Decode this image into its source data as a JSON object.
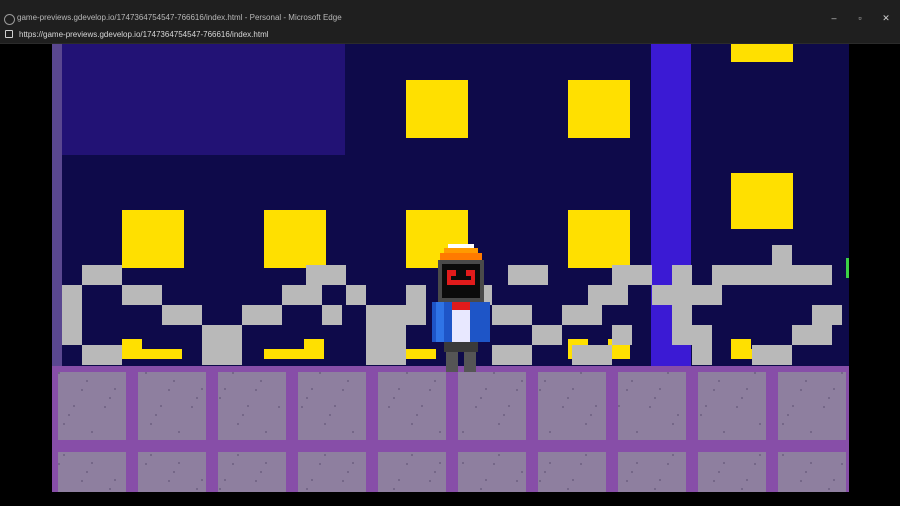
{
  "browser": {
    "window_title": "game-previews.gdevelop.io/1747364754547-766616/index.html - Personal - Microsoft Edge",
    "url": "https://game-previews.gdevelop.io/1747364754547-766616/index.html",
    "controls": {
      "minimize": "–",
      "restore": "▫",
      "close": "✕"
    },
    "icons": {
      "site": "globe-icon",
      "lock": "lock-icon"
    }
  },
  "game": {
    "colors": {
      "night_sky": "#0e0a4a",
      "window_light": "#ffe000",
      "fence": "#b9b9b9",
      "ground_tile": "#8e7f9f",
      "ground_grout": "#874ea8",
      "beam": "#3b1ad4"
    },
    "player": {
      "name": "robot-character",
      "face_color": "#e11b1b",
      "hat_color": "#ff7a00",
      "body_color": "#1e55c7"
    }
  }
}
